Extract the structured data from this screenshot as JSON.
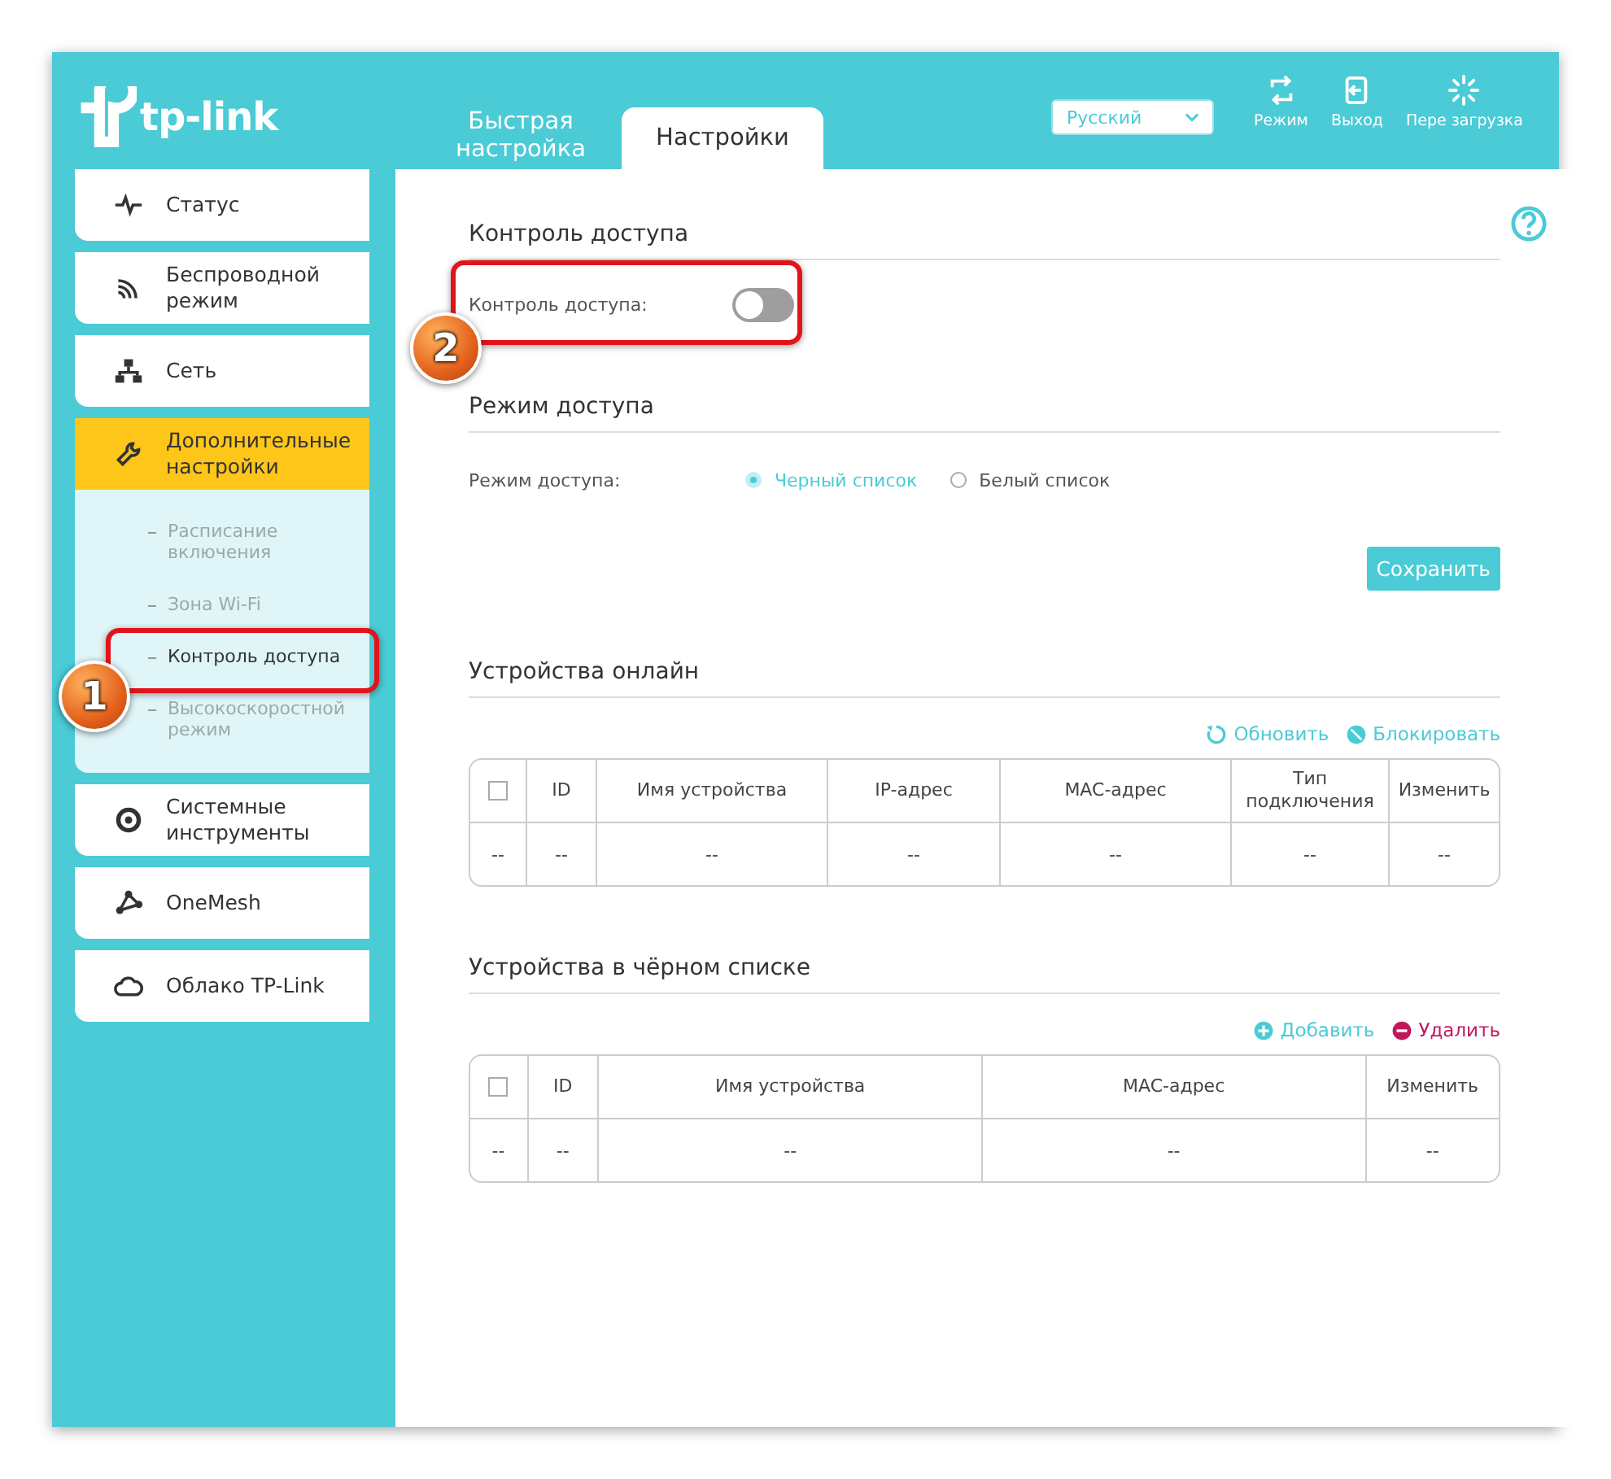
{
  "logo": {
    "text": "tp-link"
  },
  "tabs": [
    {
      "label": "Быстрая настройка",
      "selected": false
    },
    {
      "label": "Настройки",
      "selected": true
    }
  ],
  "language_select": {
    "value": "Русский"
  },
  "header_tools": [
    {
      "label": "Режим"
    },
    {
      "label": "Выход"
    },
    {
      "label": "Пере загрузка"
    }
  ],
  "sidebar": {
    "items": [
      {
        "label": "Статус",
        "selected": false
      },
      {
        "label": "Беспроводной режим",
        "selected": false
      },
      {
        "label": "Сеть",
        "selected": false
      },
      {
        "label": "Дополнительные настройки",
        "selected": true,
        "expanded": true,
        "children": [
          {
            "label": "Расписание включения",
            "selected": false
          },
          {
            "label": "Зона Wi-Fi",
            "selected": false
          },
          {
            "label": "Контроль доступа",
            "selected": true,
            "callout": "1"
          },
          {
            "label": "Высокоскоростной режим",
            "selected": false
          }
        ]
      },
      {
        "label": "Системные инструменты",
        "selected": false
      },
      {
        "label": "OneMesh",
        "selected": false
      },
      {
        "label": "Облако TP-Link",
        "selected": false
      }
    ]
  },
  "access_control": {
    "title": "Контроль доступа",
    "label": "Контроль доступа:",
    "on": false,
    "callout": "2"
  },
  "access_mode": {
    "title": "Режим доступа",
    "label": "Режим доступа:",
    "options": [
      {
        "label": "Черный список",
        "selected": true
      },
      {
        "label": "Белый список",
        "selected": false
      }
    ]
  },
  "save_button": {
    "label": "Сохранить"
  },
  "device_tables": [
    {
      "title": "Устройства онлайн",
      "actions": [
        {
          "kind": "refresh",
          "label": "Обновить",
          "color": "#4acbd6"
        },
        {
          "kind": "block",
          "label": "Блокировать",
          "color": "#4acbd6"
        }
      ],
      "columns": [
        {
          "kind": "checkbox",
          "checked": false
        },
        {
          "label": "ID"
        },
        {
          "label": "Имя устройства"
        },
        {
          "label": "IP-адрес"
        },
        {
          "label": "MAC-адрес"
        },
        {
          "label": "Тип подключения"
        },
        {
          "label": "Изменить"
        }
      ],
      "rows": [
        [
          "--",
          "--",
          "--",
          "--",
          "--",
          "--",
          "--"
        ]
      ]
    },
    {
      "title": "Устройства в чёрном списке",
      "actions": [
        {
          "kind": "add",
          "label": "Добавить",
          "color": "#4acbd6"
        },
        {
          "kind": "remove",
          "label": "Удалить",
          "color": "#c2185b"
        }
      ],
      "columns": [
        {
          "kind": "checkbox",
          "checked": false
        },
        {
          "label": "ID"
        },
        {
          "label": "Имя устройства"
        },
        {
          "label": "MAC-адрес"
        },
        {
          "label": "Изменить"
        }
      ],
      "rows": [
        [
          "--",
          "--",
          "--",
          "--",
          "--"
        ]
      ]
    }
  ]
}
